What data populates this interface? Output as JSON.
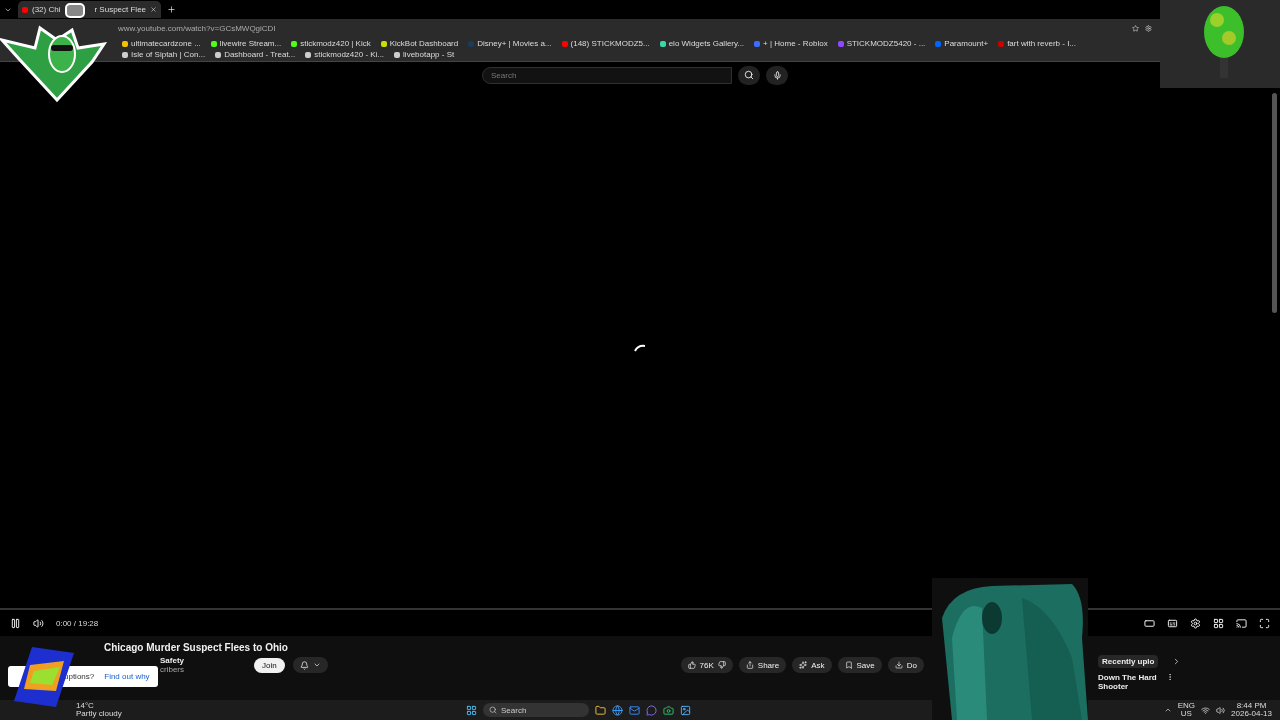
{
  "browser": {
    "tab": {
      "title_start": "(32) Chi",
      "title_end": "r Suspect Flee",
      "selected": true
    },
    "address": "www.youtube.com/watch?v=GCsMWQgiCDI",
    "bookmarks": [
      {
        "label": "ultimatecardzone ...",
        "color": "#f2c200"
      },
      {
        "label": "livewire Stream...",
        "color": "#53fc18"
      },
      {
        "label": "stickmodz420 | Kick",
        "color": "#53fc18"
      },
      {
        "label": "KickBot Dashboard",
        "color": "#c8e000"
      },
      {
        "label": "Disney+ | Movies a...",
        "color": "#1b3a5c"
      },
      {
        "label": "(148) STICKMODZ5...",
        "color": "#ff0000"
      },
      {
        "label": "elo Widgets Gallery...",
        "color": "#38d9a9"
      },
      {
        "label": "+ | Home - Roblox",
        "color": "#3b6cff"
      },
      {
        "label": "STICKMODZ5420 - ...",
        "color": "#9146ff"
      },
      {
        "label": "Paramount+",
        "color": "#0064ff"
      },
      {
        "label": "fart with reverb - I...",
        "color": "#cc0000"
      },
      {
        "label": "Isle of Siptah | Con...",
        "color": "#cccccc"
      },
      {
        "label": "Dashboard - Treat...",
        "color": "#cccccc"
      },
      {
        "label": "stickmodz420 - Ki...",
        "color": "#cccccc"
      },
      {
        "label": "livebotapp - St",
        "color": "#cccccc"
      }
    ]
  },
  "youtube": {
    "search": {
      "placeholder": "Search"
    },
    "player": {
      "time": "0:00 / 19:28"
    },
    "video": {
      "title": "Chicago Murder Suspect Flees to Ohio",
      "channel": "Safety",
      "subscribers": "cribers",
      "join": "Join",
      "tooltip": {
        "text": "uptions?",
        "link": "Find out why"
      },
      "actions": [
        {
          "kind": "like",
          "label": "76K"
        },
        {
          "kind": "share",
          "label": "Share"
        },
        {
          "kind": "ask",
          "label": "Ask"
        },
        {
          "kind": "save",
          "label": "Save"
        },
        {
          "kind": "download",
          "label": "Do"
        }
      ]
    },
    "side": {
      "chip": "Recently uplo",
      "next_title": "Down The Hard Shooter"
    }
  },
  "taskbar": {
    "weather": {
      "temp": "14°C",
      "condition": "Partly cloudy"
    },
    "search": "Search",
    "lang": "ENG",
    "region": "US",
    "time": "8:44 PM",
    "date": "2026-04-13"
  }
}
